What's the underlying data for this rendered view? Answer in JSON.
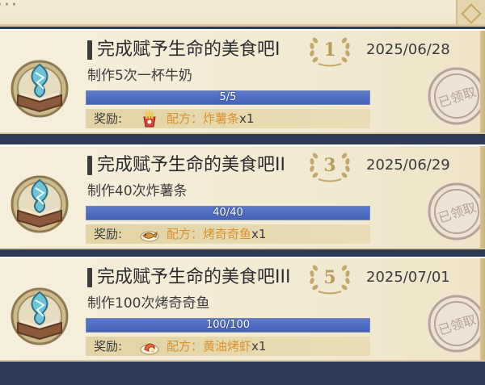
{
  "header": {
    "menu_glyph": "···"
  },
  "missions": [
    {
      "title": "完成赋予生命的美食吧I",
      "rank": "1",
      "date": "2025/06/28",
      "description": "制作5次一杯牛奶",
      "progress_text": "5/5",
      "progress_fraction": 1.0,
      "reward_label": "奖励:",
      "reward_text": "配方：炸薯条",
      "reward_count": "x1",
      "stamp_text": "已领取",
      "reward_icon": "fries-recipe-icon"
    },
    {
      "title": "完成赋予生命的美食吧II",
      "rank": "3",
      "date": "2025/06/29",
      "description": "制作40次炸薯条",
      "progress_text": "40/40",
      "progress_fraction": 1.0,
      "reward_label": "奖励:",
      "reward_text": "配方：烤奇奇鱼",
      "reward_count": "x1",
      "stamp_text": "已领取",
      "reward_icon": "grilled-fish-recipe-icon"
    },
    {
      "title": "完成赋予生命的美食吧III",
      "rank": "5",
      "date": "2025/07/01",
      "description": "制作100次烤奇奇鱼",
      "progress_text": "100/100",
      "progress_fraction": 1.0,
      "reward_label": "奖励:",
      "reward_text": "配方：黄油烤虾",
      "reward_count": "x1",
      "stamp_text": "已领取",
      "reward_icon": "butter-shrimp-recipe-icon"
    }
  ],
  "colors": {
    "progress_fill": "#4f6dc0",
    "reward_text": "#d8922f",
    "stamp": "#b6a49a",
    "laurel": "#c3a86a"
  }
}
